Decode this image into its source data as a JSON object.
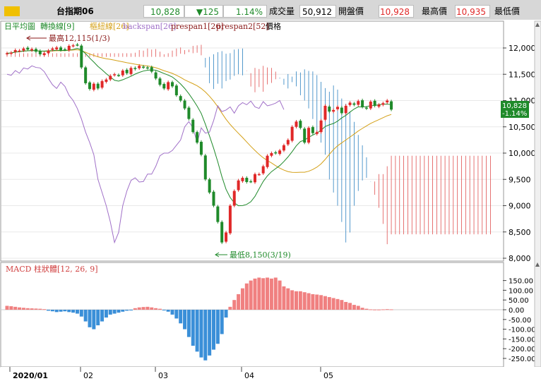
{
  "header": {
    "symbol": "台指期06",
    "last": "10,828",
    "change": "▼125",
    "change_pct": "1.14%",
    "volume_label": "成交量",
    "volume": "50,912",
    "open_label": "開盤價",
    "open": "10,928",
    "high_label": "最高價",
    "high": "10,935",
    "low_label": "最低價"
  },
  "legend": {
    "ma": "日平均圖",
    "conversion": "轉換線[9]",
    "base": "樞紐線[26]",
    "backspan": "backspan[26]",
    "prespan1": "prespan1[26]",
    "prespan2": "prespan2[52]",
    "price": "價格"
  },
  "annotations": {
    "high": "最高12,115(1/3)",
    "low": "最低8,150(3/19)"
  },
  "price_tag": {
    "value": "10,828",
    "pct": "-1.14%"
  },
  "colors": {
    "up": "#e02828",
    "down": "#1f8a2a",
    "macd_pos": "#f08080",
    "macd_neg": "#3a8fd8",
    "conversion": "#1f8a2a",
    "base": "#d4a017",
    "backspan": "#a070c8",
    "cloud_bull": "#e05050",
    "cloud_bear": "#2a80c0"
  },
  "chart_data": [
    {
      "type": "candlestick",
      "title": "",
      "yticks": [
        "12,000",
        "11,500",
        "11,000",
        "10,500",
        "10,000",
        "9,500",
        "9,000",
        "8,500",
        "8,000"
      ],
      "ylim": [
        8000,
        12250
      ],
      "xticks": [
        "2020/01",
        "02",
        "03",
        "04",
        "05"
      ],
      "high_point": {
        "date": "1/3",
        "value": 12115
      },
      "low_point": {
        "date": "3/19",
        "value": 8150
      },
      "last": 10828,
      "closes": [
        11900,
        11910,
        11960,
        11950,
        11990,
        11970,
        11980,
        11930,
        11880,
        11900,
        11950,
        11990,
        12010,
        11960,
        11970,
        12040,
        12050,
        12060,
        11630,
        11330,
        11220,
        11320,
        11230,
        11370,
        11400,
        11470,
        11500,
        11480,
        11570,
        11520,
        11620,
        11600,
        11660,
        11630,
        11620,
        11550,
        11420,
        11300,
        11230,
        11350,
        11270,
        11100,
        11000,
        10850,
        10650,
        10400,
        10200,
        9970,
        9500,
        9250,
        9000,
        8690,
        8300,
        8490,
        9000,
        9280,
        9480,
        9530,
        9450,
        9460,
        9600,
        9600,
        9750,
        9950,
        10000,
        10000,
        10050,
        10150,
        10250,
        10500,
        10600,
        10480,
        10200,
        10480,
        10380,
        10400,
        10620,
        10900,
        10790,
        10820,
        10880,
        10760,
        10900,
        10960,
        10920,
        10990,
        10880,
        10850,
        10980,
        10900,
        10920,
        10950,
        11000,
        10828
      ]
    },
    {
      "type": "bar",
      "title": "MACD 柱狀體[12, 26, 9]",
      "yticks": [
        "150.00",
        "100.00",
        "50.00",
        "0.00",
        "-50.00",
        "-100.00",
        "-150.00",
        "-200.00",
        "-250.00"
      ],
      "ylim": [
        -280,
        180
      ],
      "values": [
        20,
        18,
        15,
        12,
        10,
        8,
        7,
        6,
        5,
        3,
        -5,
        -8,
        -12,
        -10,
        -8,
        -12,
        -15,
        -20,
        -35,
        -60,
        -90,
        -100,
        -80,
        -60,
        -40,
        -25,
        -20,
        -15,
        -10,
        -5,
        -3,
        8,
        12,
        14,
        15,
        12,
        8,
        5,
        -2,
        -10,
        -25,
        -45,
        -70,
        -100,
        -140,
        -185,
        -215,
        -245,
        -260,
        -235,
        -205,
        -175,
        -125,
        -40,
        15,
        50,
        80,
        110,
        135,
        150,
        160,
        165,
        162,
        165,
        160,
        165,
        150,
        120,
        110,
        100,
        95,
        95,
        90,
        85,
        80,
        78,
        75,
        70,
        65,
        60,
        55,
        50,
        40,
        35,
        25,
        20,
        10,
        5,
        2,
        1,
        1,
        2,
        3,
        2
      ]
    }
  ]
}
